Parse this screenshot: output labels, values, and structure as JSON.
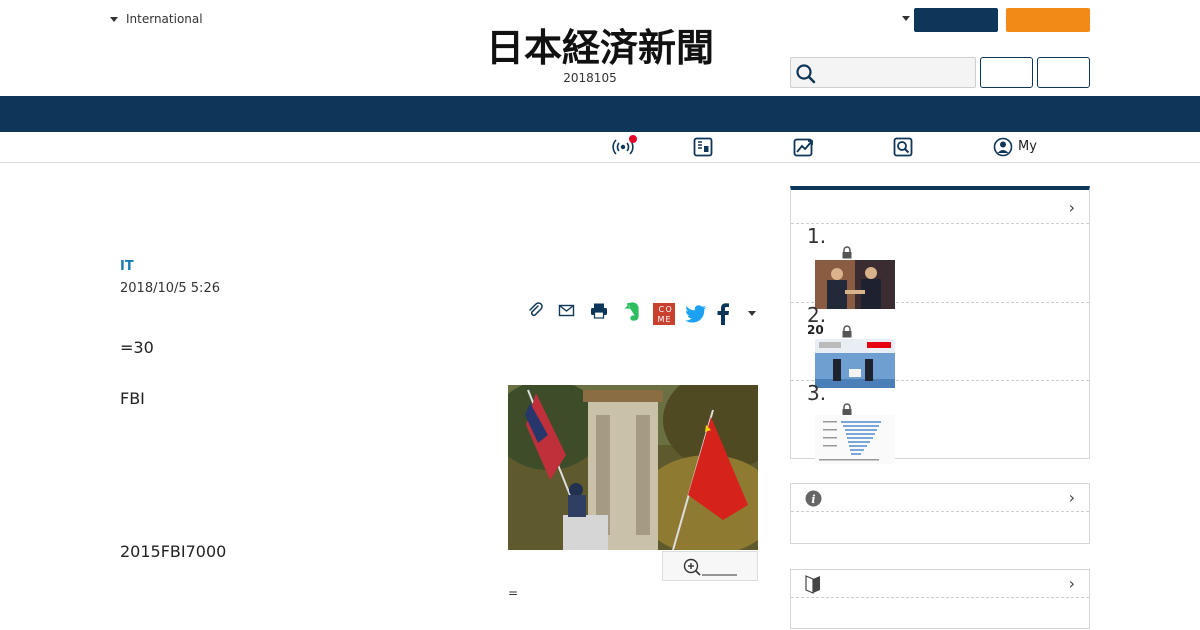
{
  "header": {
    "edition_label": "International",
    "logo_text": "日本経済新聞",
    "logo_date": "2018105"
  },
  "subnav": {
    "my_label": "My"
  },
  "article": {
    "tag": "IT",
    "date": "2018/10/5 5:26",
    "paragraphs": [
      "=30",
      "FBI",
      "2015FBI7000"
    ],
    "caption": "="
  },
  "sidebar": {
    "ranking": {
      "items": [
        {
          "num": "1.",
          "sub": ""
        },
        {
          "num": "2.",
          "sub": "20"
        },
        {
          "num": "3.",
          "sub": ""
        }
      ]
    }
  },
  "colors": {
    "brand_navy": "#0e3658",
    "accent_orange": "#f28a17",
    "tag_blue": "#1b7bb5",
    "notify_red": "#e4002b"
  },
  "icons": {
    "subnav": [
      "broadcast-icon",
      "paper-icon",
      "chart-icon",
      "search-icon",
      "user-icon"
    ],
    "share": [
      "clip-icon",
      "mail-icon",
      "print-icon",
      "evernote-icon",
      "comemo-icon",
      "twitter-icon",
      "facebook-icon",
      "more-caret-icon"
    ]
  }
}
